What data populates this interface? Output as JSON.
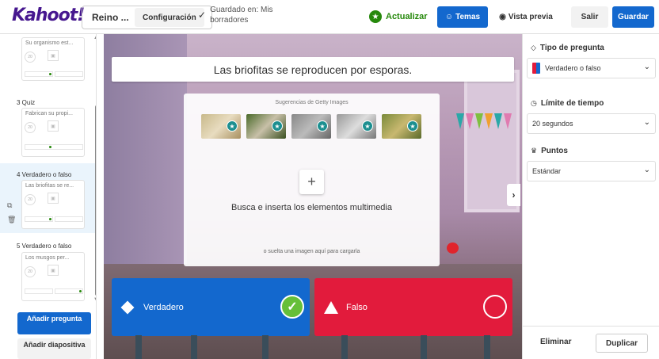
{
  "header": {
    "logo": "Kahoot!",
    "kahoot_title": "Reino ...",
    "config_label": "Configuración",
    "saved_text": "Guardado en: Mis borradores",
    "update_label": "Actualizar",
    "themes_label": "Temas",
    "preview_label": "Vista previa",
    "exit_label": "Salir",
    "save_label": "Guardar"
  },
  "sidebar": {
    "slides": [
      {
        "label": "",
        "preview": "Su organismo est..."
      },
      {
        "label": "3 Quiz",
        "preview": "Fabrican su propi..."
      },
      {
        "label": "4 Verdadero o falso",
        "preview": "Las briofitas se re..."
      },
      {
        "label": "5 Verdadero o falso",
        "preview": "Los musgos per..."
      }
    ],
    "timer_badge": "20",
    "add_question": "Añadir pregunta",
    "add_slide": "Añadir diapositiva"
  },
  "canvas": {
    "question": "Las briofitas se reproducen por esporas.",
    "getty_label": "Sugerencias de Getty Images",
    "media_main": "Busca e inserta los elementos multimedia",
    "media_sub": "o suelta una imagen aquí para cargarla",
    "answers": [
      {
        "label": "Verdadero",
        "color": "#1368ce",
        "correct": true
      },
      {
        "label": "Falso",
        "color": "#e21b3c",
        "correct": false
      }
    ]
  },
  "right_panel": {
    "question_type_label": "Tipo de pregunta",
    "question_type_value": "Verdadero o falso",
    "time_limit_label": "Límite de tiempo",
    "time_limit_value": "20 segundos",
    "points_label": "Puntos",
    "points_value": "Estándar",
    "delete_label": "Eliminar",
    "duplicate_label": "Duplicar"
  },
  "colors": {
    "brand": "#46178f",
    "primary": "#1368ce",
    "success": "#26890c",
    "danger": "#e21b3c"
  }
}
